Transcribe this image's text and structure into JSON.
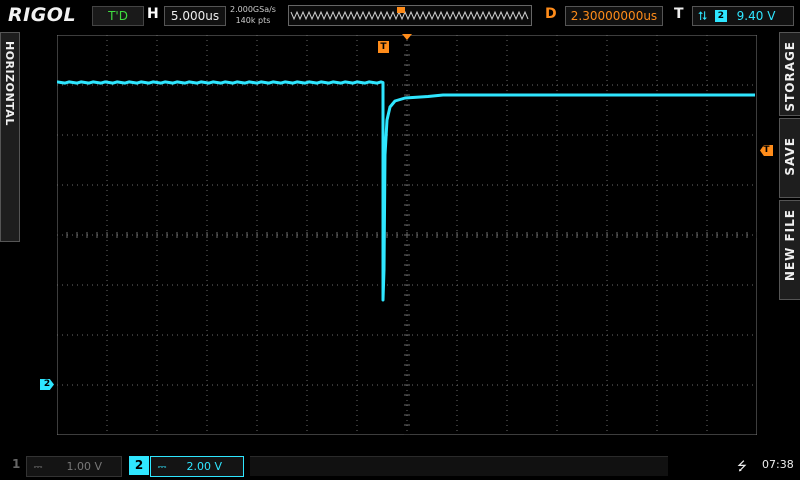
{
  "header": {
    "brand": "RIGOL",
    "mode": "T'D",
    "timebase_key": "H",
    "timebase": "5.000us",
    "sample_rate": "2.000GSa/s",
    "memory_depth": "140k pts",
    "delay_key": "D",
    "delay": "2.30000000us",
    "trigger_key": "T",
    "trigger_channel": "2",
    "trigger_level": "9.40 V"
  },
  "side_tabs": {
    "left": "HORIZONTAL",
    "right_top": "STORAGE",
    "right_mid": "SAVE",
    "right_bottom": "NEW FILE"
  },
  "markers": {
    "trigger_position": "T",
    "trigger_level": "T",
    "ch2_ground": "2"
  },
  "channels": [
    {
      "number": "1",
      "coupling": "⎓",
      "scale": "1.00 V",
      "active": false
    },
    {
      "number": "2",
      "coupling": "⎓",
      "scale": "2.00 V",
      "active": true
    }
  ],
  "status": {
    "usb_icon": "usb-icon",
    "clock": "07:38"
  },
  "colors": {
    "ch2": "#2fe6ff",
    "trigger": "#ff8c1a",
    "grid": "#6a6a6a",
    "mode": "#3fdc3f"
  },
  "waveform": {
    "grid_divisions": [
      14,
      8
    ],
    "units": "divisions from left / top edge",
    "pre_trigger_level_div": 0.95,
    "settled_level_div": 1.2,
    "step_time_div": 6.52,
    "dip_min_div": 5.3
  }
}
